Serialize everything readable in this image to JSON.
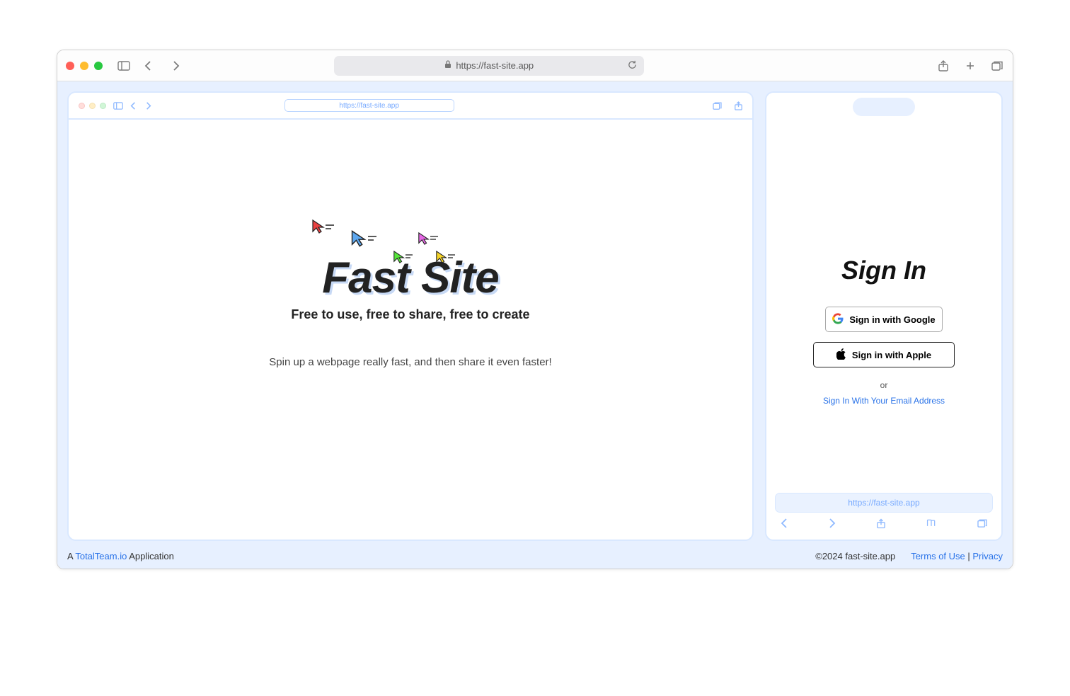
{
  "browser": {
    "url": "https://fast-site.app"
  },
  "miniBrowser": {
    "url": "https://fast-site.app"
  },
  "hero": {
    "title": "Fast Site",
    "subtitle": "Free to use, free to share, free to create",
    "description": "Spin up a webpage really fast, and then share it even faster!"
  },
  "signin": {
    "title": "Sign In",
    "google": "Sign in with Google",
    "apple": "Sign in with Apple",
    "or": "or",
    "emailLink": "Sign In With Your Email Address"
  },
  "mobile": {
    "url": "https://fast-site.app"
  },
  "footer": {
    "prefix": "A ",
    "brandLink": "TotalTeam.io",
    "suffix": " Application",
    "copyright": "©2024 fast-site.app",
    "terms": "Terms of Use",
    "sep": " | ",
    "privacy": "Privacy"
  }
}
